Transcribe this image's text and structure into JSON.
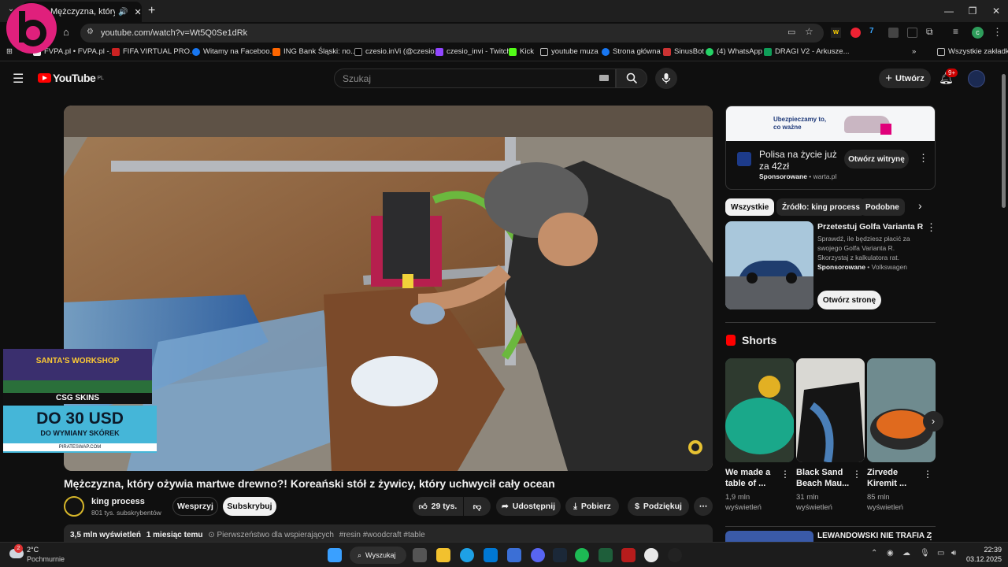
{
  "browser": {
    "tab_title": "Mężczyzna, który ożyw",
    "url": "youtube.com/watch?v=Wt5Q0Se1dRk",
    "bookmarks": [
      "FVPA.pl • FVPA.pl -...",
      "FIFA VIRTUAL PRO...",
      "Witamy na Faceboo...",
      "ING Bank Śląski: no...",
      "czesio.inVi (@czesio...",
      "czesio_invi - Twitch",
      "Kick",
      "youtube muza",
      "Strona główna",
      "SinusBot",
      "(4) WhatsApp",
      "DRAGI V2 - Arkusze..."
    ],
    "all_bookmarks": "Wszystkie zakładki"
  },
  "youtube": {
    "logo_text": "YouTube",
    "logo_country": "PL",
    "search_placeholder": "Szukaj",
    "create_label": "Utwórz",
    "notif_count": "9+"
  },
  "ad_overlay": {
    "top_text": "SANTA'S WORKSHOP",
    "brand": "CSG SKINS",
    "headline": "DO 30 USD",
    "sub": "DO WYMIANY SKÓREK",
    "site": "PIRATESWAP.COM"
  },
  "video": {
    "title": "Mężczyzna, który ożywia martwe drewno?! Koreański stół z żywicy, który uchwycił cały ocean",
    "channel": "king process",
    "subscribers": "801 tys. subskrybentów",
    "support_label": "Wesprzyj",
    "subscribe_label": "Subskrybuj",
    "likes": "29 tys.",
    "share_label": "Udostępnij",
    "download_label": "Pobierz",
    "thanks_label": "Podziękuj",
    "views": "3,5 mln wyświetleń",
    "age": "1 miesiąc temu",
    "priority": "Pierwszeństwo dla wspierających",
    "tags": "#resin #woodcraft #table"
  },
  "sidebar": {
    "ad1": {
      "banner_line1": "Ubezpieczamy to,",
      "banner_line2": "co ważne",
      "title": "Polisa na życie już za 42zł",
      "sponsored": "Sponsorowane",
      "domain": "warta.pl",
      "button": "Otwórz witrynę"
    },
    "chips": [
      "Wszystkie",
      "Źródło: king process",
      "Podobne"
    ],
    "ad2": {
      "title": "Przetestuj Golfa Varianta R",
      "desc": "Sprawdź, ile będziesz płacić za swojego Golfa Varianta R. Skorzystaj z kalkulatora rat.",
      "sponsored": "Sponsorowane",
      "brand": "Volkswagen",
      "button": "Otwórz stronę"
    },
    "shorts_heading": "Shorts",
    "shorts": [
      {
        "title": "We made a table of ...",
        "views": "1,9 mln",
        "views_unit": "wyświetleń"
      },
      {
        "title": "Black Sand Beach Mau...",
        "views": "31 mln",
        "views_unit": "wyświetleń"
      },
      {
        "title": "Zirvede Kiremit ...",
        "views": "85 mln",
        "views_unit": "wyświetleń"
      }
    ],
    "next_title": "LEWANDOWSKI NIE TRAFIA Z"
  },
  "taskbar": {
    "temp": "2°C",
    "weather": "Pochmurnie",
    "search_label": "Wyszukaj",
    "time": "22:39",
    "date": "03.12.2025",
    "weather_badge": "2"
  }
}
